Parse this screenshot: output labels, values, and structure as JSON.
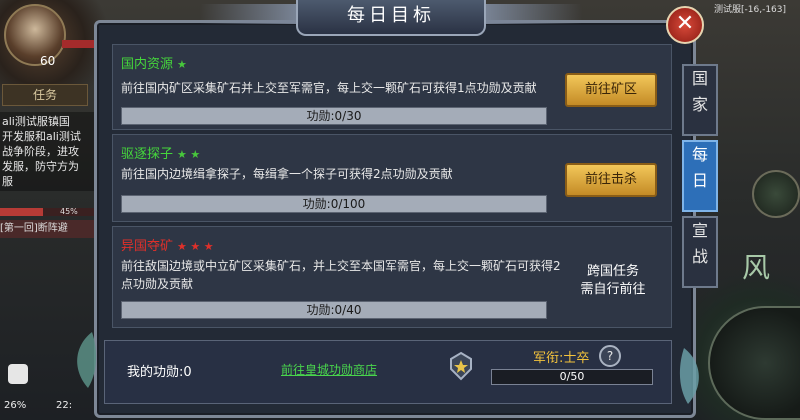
{
  "player": {
    "level": "60",
    "task_tab": "任务",
    "coords": "测试服[-16,-163]"
  },
  "side_text": "ali测试服镇国\n开发服和ali测试\n战争阶段，进攻\n发服，防守方为\n服",
  "side": {
    "exp_percent": "45%",
    "exp_fill": 0.45,
    "chapter": "[第一回]断阵避",
    "battery": "26%",
    "time": "22:"
  },
  "panel": {
    "title": "每日目标",
    "close_icon": "close-icon",
    "tabs": [
      {
        "label": "国家",
        "active": false
      },
      {
        "label": "每日",
        "active": true
      },
      {
        "label": "宣战",
        "active": false
      }
    ]
  },
  "tasks": [
    {
      "name": "国内资源",
      "stars": "★",
      "name_color": "#45d63c",
      "desc1": "前往国内矿区采集矿石并上交至军需官，每上交一颗矿石可获得1点功勋及贡献",
      "desc2": "",
      "progress": "功勋:0/30",
      "button": "前往矿区"
    },
    {
      "name": "驱逐探子",
      "stars": "★ ★",
      "name_color": "#45d63c",
      "desc1": "前往国内边境缉拿探子，每缉拿一个探子可获得2点功勋及贡献",
      "desc2": "",
      "progress": "功勋:0/100",
      "button": "前往击杀"
    },
    {
      "name": "异国夺矿",
      "stars": "★ ★ ★",
      "name_color": "#e0302a",
      "desc1": "前往敌国边境或中立矿区采集矿石，并上交至本国军需官，每上交一颗矿石可获得2",
      "desc2": "点功勋及贡献",
      "progress": "功勋:0/40",
      "note1": "跨国任务",
      "note2": "需自行前往"
    }
  ],
  "footer": {
    "my_merit": "我的功勋:0",
    "shop_link": "前往皇城功勋商店",
    "rank_label": "军衔:士卒",
    "help": "?",
    "rank_progress": "0/50",
    "rank_icon": "rank-badge-icon"
  },
  "colors": {
    "accent_gold": "#f2c23c",
    "link_green": "#49d64c",
    "tab_active": "#2d6fb8"
  }
}
